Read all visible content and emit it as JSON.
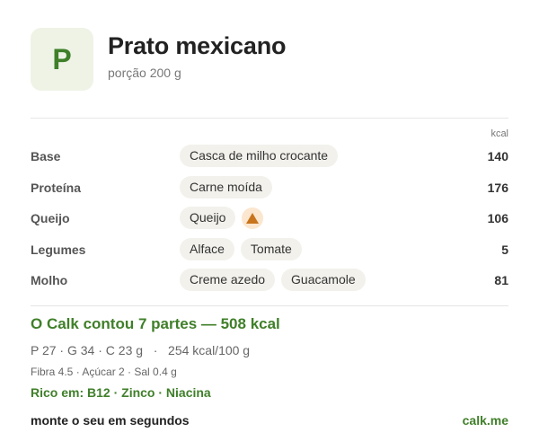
{
  "header": {
    "logo_letter": "P",
    "title": "Prato mexicano",
    "portion": "porção 200 g"
  },
  "table": {
    "kcal_unit": "kcal",
    "rows": [
      {
        "label": "Base",
        "items": [
          "Casca de milho crocante"
        ],
        "kcal": "140"
      },
      {
        "label": "Proteína",
        "items": [
          "Carne moída"
        ],
        "kcal": "176"
      },
      {
        "label": "Queijo",
        "items": [
          "Queijo"
        ],
        "warning_icon": "warning-triangle-icon",
        "kcal": "106"
      },
      {
        "label": "Legumes",
        "items": [
          "Alface",
          "Tomate"
        ],
        "kcal": "5"
      },
      {
        "label": "Molho",
        "items": [
          "Creme azedo",
          "Guacamole"
        ],
        "kcal": "81"
      }
    ]
  },
  "summary": {
    "headline": "O Calk contou 7 partes — 508 kcal",
    "macros": "P 27 · G 34 · C 23 g   ·   254 kcal/100 g",
    "micros": "Fibra 4.5 · Açúcar 2 · Sal 0.4 g",
    "rich_in": "Rico em: B12 · Zinco · Niacina"
  },
  "footer": {
    "cta": "monte o seu em segundos",
    "link": "calk.me"
  },
  "colors": {
    "accent": "#3f7f29",
    "logo_bg": "#eef3e6",
    "chip_bg": "#f2f1ec",
    "warning": "#c8741c"
  }
}
